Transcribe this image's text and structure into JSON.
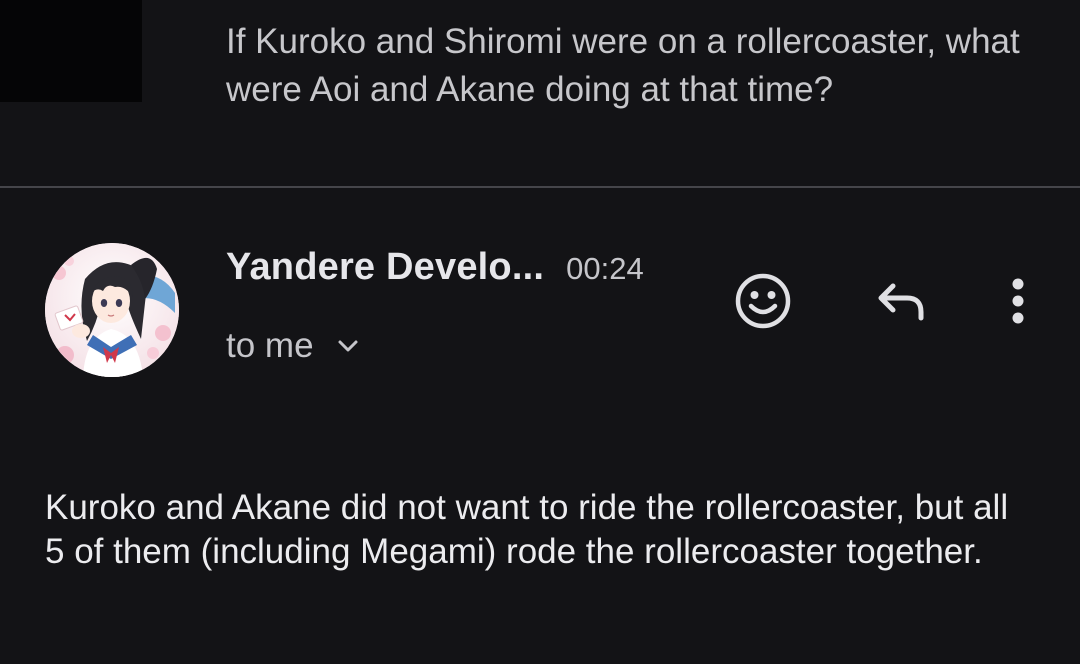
{
  "previous_message": {
    "text": "If Kuroko and Shiromi were on a rollercoaster, what were Aoi and Akane doing at that time?"
  },
  "message": {
    "sender": "Yandere Develo...",
    "time": "00:24",
    "recipient": "to me",
    "body": "Kuroko and Akane did not want to ride the rollercoaster, but all 5 of them (including Megami) rode the rollercoaster together."
  },
  "icons": {
    "emoji": "smiley-face-icon",
    "reply": "reply-arrow-icon",
    "more": "more-vertical-icon",
    "expand": "chevron-down-icon"
  },
  "colors": {
    "background": "#131316",
    "text": "#e3e3e6",
    "divider": "#45454a"
  }
}
